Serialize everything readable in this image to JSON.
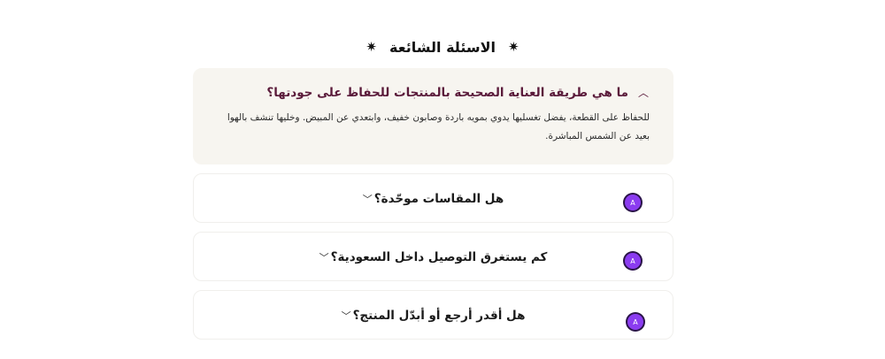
{
  "faq": {
    "title": "الاسئلة الشائعة",
    "title_icon": "sparkle-icon",
    "items": [
      {
        "question": "ما هي طريقة العناية الصحيحة بالمنتجات للحفاظ على جودتها؟",
        "answer": "للحفاظ على القطعة، يفضل تغسليها يدوي بمويه باردة وصابون خفيف، وابتعدي عن المبيض. وخليها تنشف بالهوا بعيد عن الشمس المباشرة.",
        "expanded": true
      },
      {
        "question": "هل المقاسات موحّدة؟",
        "expanded": false
      },
      {
        "question": "كم يستغرق التوصيل داخل السعودية؟",
        "expanded": false
      },
      {
        "question": "هل أقدر أرجع أو أبدّل المنتج؟",
        "expanded": false
      }
    ],
    "badge_letter": "A"
  },
  "colors": {
    "accent": "#5a1a3a",
    "open_bg": "#f7f5f0",
    "badge": "#8b3cf0"
  }
}
